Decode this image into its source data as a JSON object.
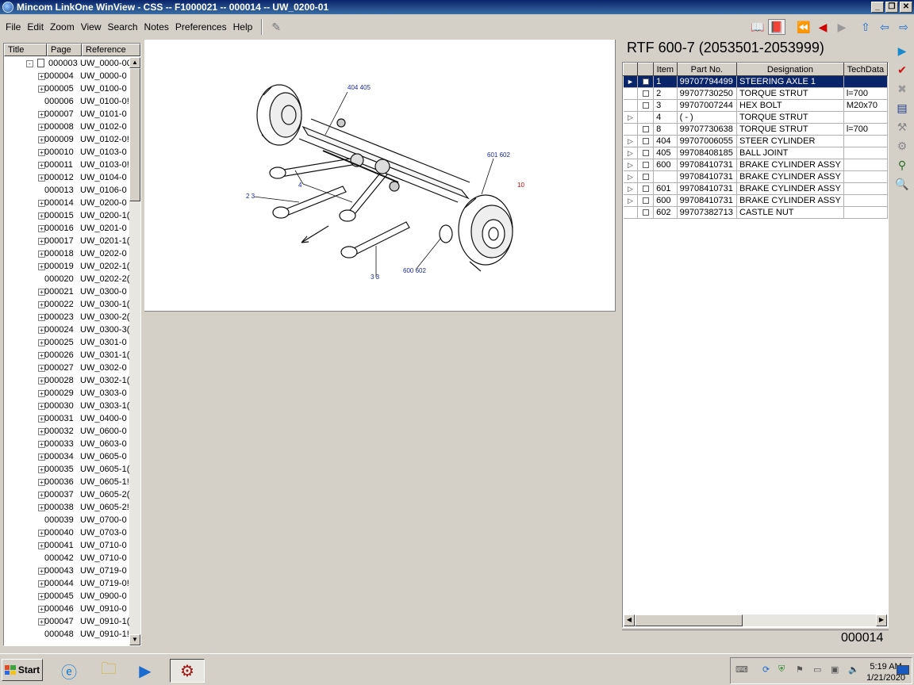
{
  "window": {
    "title": "Mincom LinkOne WinView - CSS -- F1000021 -- 000014 -- UW_0200-01",
    "minimize": "_",
    "restore": "❐",
    "close": "✕"
  },
  "menu": {
    "items": [
      "File",
      "Edit",
      "Zoom",
      "View",
      "Search",
      "Notes",
      "Preferences",
      "Help"
    ]
  },
  "toolbar": {
    "icons": [
      "book-icon",
      "bookmark-icon",
      "first-icon",
      "prev-icon",
      "next-icon",
      "up-icon",
      "back-icon",
      "forward-icon"
    ]
  },
  "tree": {
    "headers": [
      "Title",
      "Page",
      "Reference"
    ],
    "rows": [
      {
        "title": "000003",
        "page": "UW_0000-00",
        "exp": "-"
      },
      {
        "title": "000004",
        "page": "UW_0000-0",
        "exp": "+"
      },
      {
        "title": "000005",
        "page": "UW_0100-0",
        "exp": "+"
      },
      {
        "title": "000006",
        "page": "UW_0100-0!",
        "exp": ""
      },
      {
        "title": "000007",
        "page": "UW_0101-0",
        "exp": "+"
      },
      {
        "title": "000008",
        "page": "UW_0102-0",
        "exp": "+"
      },
      {
        "title": "000009",
        "page": "UW_0102-0!",
        "exp": "+"
      },
      {
        "title": "000010",
        "page": "UW_0103-0",
        "exp": "+"
      },
      {
        "title": "000011",
        "page": "UW_0103-0!",
        "exp": "+"
      },
      {
        "title": "000012",
        "page": "UW_0104-0",
        "exp": "+"
      },
      {
        "title": "000013",
        "page": "UW_0106-0",
        "exp": ""
      },
      {
        "title": "000014",
        "page": "UW_0200-0",
        "exp": "+"
      },
      {
        "title": "000015",
        "page": "UW_0200-1(",
        "exp": "+"
      },
      {
        "title": "000016",
        "page": "UW_0201-0",
        "exp": "+"
      },
      {
        "title": "000017",
        "page": "UW_0201-1(",
        "exp": "+"
      },
      {
        "title": "000018",
        "page": "UW_0202-0",
        "exp": "+"
      },
      {
        "title": "000019",
        "page": "UW_0202-1(",
        "exp": "+"
      },
      {
        "title": "000020",
        "page": "UW_0202-2(",
        "exp": ""
      },
      {
        "title": "000021",
        "page": "UW_0300-0",
        "exp": "+"
      },
      {
        "title": "000022",
        "page": "UW_0300-1(",
        "exp": "+"
      },
      {
        "title": "000023",
        "page": "UW_0300-2(",
        "exp": "+"
      },
      {
        "title": "000024",
        "page": "UW_0300-3(",
        "exp": "+"
      },
      {
        "title": "000025",
        "page": "UW_0301-0",
        "exp": "+"
      },
      {
        "title": "000026",
        "page": "UW_0301-1(",
        "exp": "+"
      },
      {
        "title": "000027",
        "page": "UW_0302-0",
        "exp": "+"
      },
      {
        "title": "000028",
        "page": "UW_0302-1(",
        "exp": "+"
      },
      {
        "title": "000029",
        "page": "UW_0303-0",
        "exp": "+"
      },
      {
        "title": "000030",
        "page": "UW_0303-1(",
        "exp": "+"
      },
      {
        "title": "000031",
        "page": "UW_0400-0",
        "exp": "+"
      },
      {
        "title": "000032",
        "page": "UW_0600-0",
        "exp": "+"
      },
      {
        "title": "000033",
        "page": "UW_0603-0",
        "exp": "+"
      },
      {
        "title": "000034",
        "page": "UW_0605-0",
        "exp": "+"
      },
      {
        "title": "000035",
        "page": "UW_0605-1(",
        "exp": "+"
      },
      {
        "title": "000036",
        "page": "UW_0605-1!",
        "exp": "+"
      },
      {
        "title": "000037",
        "page": "UW_0605-2(",
        "exp": "+"
      },
      {
        "title": "000038",
        "page": "UW_0605-2!",
        "exp": "+"
      },
      {
        "title": "000039",
        "page": "UW_0700-0",
        "exp": ""
      },
      {
        "title": "000040",
        "page": "UW_0703-0",
        "exp": "+"
      },
      {
        "title": "000041",
        "page": "UW_0710-0",
        "exp": "+"
      },
      {
        "title": "000042",
        "page": "UW_0710-0",
        "exp": ""
      },
      {
        "title": "000043",
        "page": "UW_0719-0",
        "exp": "+"
      },
      {
        "title": "000044",
        "page": "UW_0719-0!",
        "exp": "+"
      },
      {
        "title": "000045",
        "page": "UW_0900-0",
        "exp": "+"
      },
      {
        "title": "000046",
        "page": "UW_0910-0",
        "exp": "+"
      },
      {
        "title": "000047",
        "page": "UW_0910-1(",
        "exp": "+"
      },
      {
        "title": "000048",
        "page": "UW_0910-1!",
        "exp": ""
      }
    ]
  },
  "drawing": {
    "callouts": [
      "404 405",
      "601 602",
      "4",
      "2 3",
      "3 3",
      "600 602",
      "10"
    ]
  },
  "parts": {
    "title": "RTF 600-7 (2053501-2053999)",
    "columns": [
      "",
      "",
      "Item",
      "Part No.",
      "Designation",
      "TechData"
    ],
    "rows": [
      {
        "arrow": "►",
        "chk": true,
        "item": "1",
        "part": "99707794499",
        "desig": "STEERING AXLE 1",
        "tech": "",
        "selected": true
      },
      {
        "arrow": "",
        "chk": true,
        "item": "2",
        "part": "99707730250",
        "desig": "TORQUE STRUT",
        "tech": "l=700"
      },
      {
        "arrow": "",
        "chk": true,
        "item": "3",
        "part": "99707007244",
        "desig": "HEX BOLT",
        "tech": "M20x70"
      },
      {
        "arrow": "▷",
        "chk": false,
        "item": "4",
        "part": "(   -   )",
        "desig": "TORQUE STRUT",
        "tech": ""
      },
      {
        "arrow": "",
        "chk": true,
        "item": "8",
        "part": "99707730638",
        "desig": "TORQUE STRUT",
        "tech": "l=700"
      },
      {
        "arrow": "▷",
        "chk": true,
        "item": "404",
        "part": "99707006055",
        "desig": "STEER CYLINDER",
        "tech": ""
      },
      {
        "arrow": "▷",
        "chk": true,
        "item": "405",
        "part": "99708408185",
        "desig": "BALL JOINT",
        "tech": ""
      },
      {
        "arrow": "▷",
        "chk": true,
        "item": "600",
        "part": "99708410731",
        "desig": "BRAKE CYLINDER ASSY",
        "tech": ""
      },
      {
        "arrow": "▷",
        "chk": true,
        "item": "",
        "part": "99708410731",
        "desig": "BRAKE CYLINDER ASSY",
        "tech": ""
      },
      {
        "arrow": "▷",
        "chk": true,
        "item": "601",
        "part": "99708410731",
        "desig": "BRAKE CYLINDER ASSY",
        "tech": ""
      },
      {
        "arrow": "▷",
        "chk": true,
        "item": "600",
        "part": "99708410731",
        "desig": "BRAKE CYLINDER ASSY",
        "tech": ""
      },
      {
        "arrow": "",
        "chk": true,
        "item": "602",
        "part": "99707382713",
        "desig": "CASTLE NUT",
        "tech": ""
      }
    ],
    "page_number": "000014"
  },
  "taskbar": {
    "start": "Start",
    "time": "5:19 AM",
    "date": "1/21/2020"
  }
}
